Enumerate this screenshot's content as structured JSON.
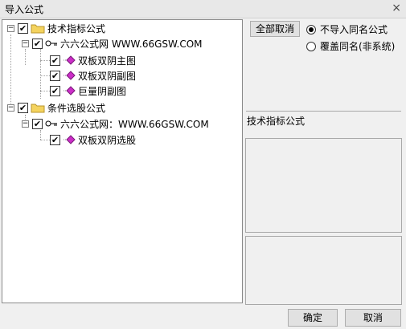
{
  "window": {
    "title": "导入公式",
    "close_icon": "×"
  },
  "tree": {
    "nodes": [
      {
        "label": "技术指标公式",
        "toggle": "−",
        "check": "✔",
        "icon": "folder-icon"
      },
      {
        "label": "六六公式网 WWW.66GSW.COM",
        "toggle": "−",
        "check": "✔",
        "icon": "key-icon"
      },
      {
        "label": "双板双阴主图",
        "check": "✔",
        "icon": "formula-icon"
      },
      {
        "label": "双板双阴副图",
        "check": "✔",
        "icon": "formula-icon"
      },
      {
        "label": "巨量阴副图",
        "check": "✔",
        "icon": "formula-icon"
      },
      {
        "label": "条件选股公式",
        "toggle": "−",
        "check": "✔",
        "icon": "folder-icon"
      },
      {
        "label": "六六公式网：WWW.66GSW.COM",
        "toggle": "−",
        "check": "✔",
        "icon": "key-icon"
      },
      {
        "label": "双板双阴选股",
        "check": "✔",
        "icon": "formula-icon"
      }
    ]
  },
  "options": {
    "cancel_all_label": "全部取消",
    "radio1_label": "不导入同名公式",
    "radio2_label": "覆盖同名(非系统)",
    "selected": "radio1"
  },
  "info": {
    "type_label": "技术指标公式"
  },
  "footer": {
    "ok_label": "确定",
    "cancel_label": "取消"
  },
  "colors": {
    "folder": "#f4d35e",
    "formula": "#cc2ec8",
    "accent": "#000000"
  }
}
